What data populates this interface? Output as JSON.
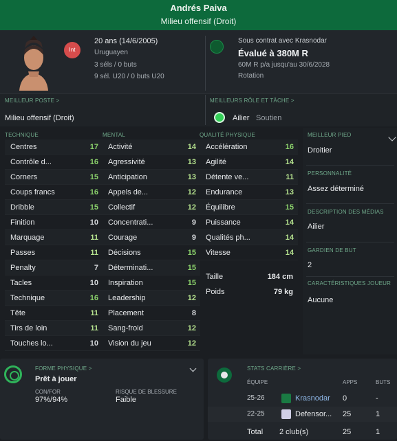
{
  "header": {
    "name": "Andrés Paiva",
    "position": "Milieu offensif (Droit)"
  },
  "profile": {
    "int_badge": "Int",
    "age": "20 ans (14/6/2005)",
    "nationality": "Uruguayen",
    "caps": "3 séls / 0 buts",
    "youth_caps": "9 sél. U20 / 0 buts U20"
  },
  "contract": {
    "status": "Sous contrat avec Krasnodar",
    "value": "Évalué à 380M R",
    "wage": "60M R p/a jusqu'au 30/6/2028",
    "squad_status": "Rotation"
  },
  "best_position": {
    "label": "MEILLEUR POSTE >",
    "value": "Milieu offensif (Droit)"
  },
  "best_role": {
    "label": "MEILLEURS RÔLE ET TÂCHE >",
    "role": "Ailier",
    "duty": "Soutien"
  },
  "columns": {
    "technical": {
      "label": "TECHNIQUE",
      "items": [
        {
          "name": "Centres",
          "value": "17"
        },
        {
          "name": "Contrôle d...",
          "value": "16"
        },
        {
          "name": "Corners",
          "value": "15"
        },
        {
          "name": "Coups francs",
          "value": "16"
        },
        {
          "name": "Dribble",
          "value": "15"
        },
        {
          "name": "Finition",
          "value": "10"
        },
        {
          "name": "Marquage",
          "value": "11"
        },
        {
          "name": "Passes",
          "value": "11"
        },
        {
          "name": "Penalty",
          "value": "7"
        },
        {
          "name": "Tacles",
          "value": "10"
        },
        {
          "name": "Technique",
          "value": "16"
        },
        {
          "name": "Tête",
          "value": "11"
        },
        {
          "name": "Tirs de loin",
          "value": "11"
        },
        {
          "name": "Touches lo...",
          "value": "10"
        }
      ]
    },
    "mental": {
      "label": "MENTAL",
      "items": [
        {
          "name": "Activité",
          "value": "14"
        },
        {
          "name": "Agressivité",
          "value": "13"
        },
        {
          "name": "Anticipation",
          "value": "13"
        },
        {
          "name": "Appels de...",
          "value": "12"
        },
        {
          "name": "Collectif",
          "value": "12"
        },
        {
          "name": "Concentrati...",
          "value": "9"
        },
        {
          "name": "Courage",
          "value": "9"
        },
        {
          "name": "Décisions",
          "value": "15"
        },
        {
          "name": "Déterminati...",
          "value": "15"
        },
        {
          "name": "Inspiration",
          "value": "15"
        },
        {
          "name": "Leadership",
          "value": "12"
        },
        {
          "name": "Placement",
          "value": "8"
        },
        {
          "name": "Sang-froid",
          "value": "12"
        },
        {
          "name": "Vision du jeu",
          "value": "12"
        }
      ]
    },
    "physical": {
      "label": "QUALITÉ PHYSIQUE",
      "items": [
        {
          "name": "Accélération",
          "value": "16"
        },
        {
          "name": "Agilité",
          "value": "14"
        },
        {
          "name": "Détente ve...",
          "value": "11"
        },
        {
          "name": "Endurance",
          "value": "13"
        },
        {
          "name": "Équilibre",
          "value": "15"
        },
        {
          "name": "Puissance",
          "value": "14"
        },
        {
          "name": "Qualités ph...",
          "value": "14"
        },
        {
          "name": "Vitesse",
          "value": "14"
        }
      ],
      "height_label": "Taille",
      "height": "184 cm",
      "weight_label": "Poids",
      "weight": "79 kg"
    }
  },
  "side": {
    "best_foot_label": "MEILLEUR PIED",
    "best_foot": "Droitier",
    "personality_label": "PERSONNALITÉ",
    "personality": "Assez déterminé",
    "media_label": "DESCRIPTION DES MÉDIAS",
    "media": "Ailier",
    "gk_label": "GARDIEN DE BUT",
    "gk": "2",
    "traits_label": "CARACTÉRISTIQUES JOUEUR",
    "traits": "Aucune"
  },
  "fitness": {
    "label": "FORME PHYSIQUE >",
    "status": "Prêt à jouer",
    "con_label": "CON/FOR",
    "con_value": "97%/94%",
    "injury_label": "RISQUE DE BLESSURE",
    "injury_value": "Faible"
  },
  "career": {
    "label": "STATS CARRIÈRE >",
    "headers": {
      "team": "ÉQUIPE",
      "apps": "APPS",
      "goals": "BUTS"
    },
    "rows": [
      {
        "season": "25-26",
        "club": "Krasnodar",
        "apps": "0",
        "goals": "-"
      },
      {
        "season": "22-25",
        "club": "Defensor...",
        "apps": "25",
        "goals": "1"
      }
    ],
    "total": {
      "label": "Total",
      "clubs": "2 club(s)",
      "apps": "25",
      "goals": "1"
    }
  },
  "colors": {
    "header": "#0d6a3c",
    "accent_green": "#8cd36c",
    "label_green": "#6fa88a"
  }
}
